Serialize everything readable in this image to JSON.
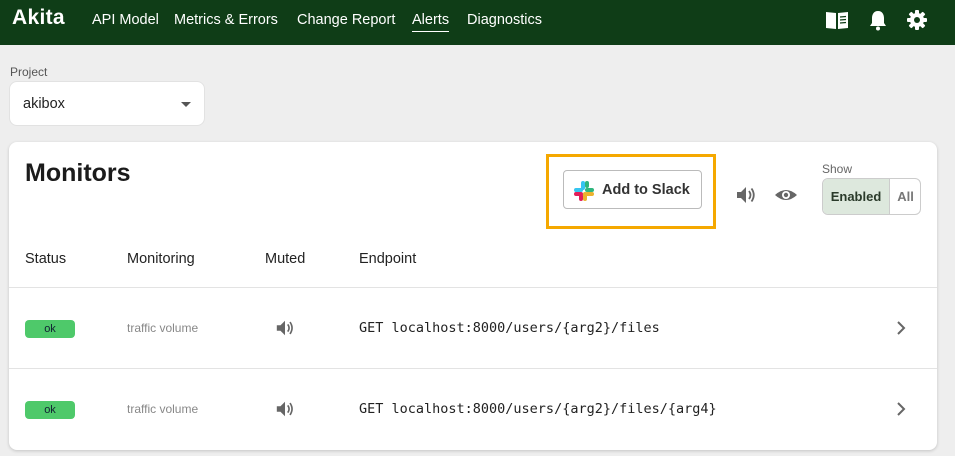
{
  "topbar": {
    "logo": "Akita",
    "nav": [
      {
        "label": "API Model",
        "active": false
      },
      {
        "label": "Metrics & Errors",
        "active": false
      },
      {
        "label": "Change Report",
        "active": false
      },
      {
        "label": "Alerts",
        "active": true
      },
      {
        "label": "Diagnostics",
        "active": false
      }
    ],
    "icons": [
      "book-icon",
      "bell-icon",
      "gear-icon"
    ],
    "background": "#0f3d17"
  },
  "project": {
    "label": "Project",
    "value": "akibox"
  },
  "monitors": {
    "title": "Monitors",
    "slack_button": "Add to Slack",
    "highlight_color": "#f5a800",
    "header_icons": [
      "speaker-icon",
      "eye-icon"
    ],
    "show": {
      "label": "Show",
      "options": [
        "Enabled",
        "All"
      ],
      "selected": "Enabled"
    },
    "columns": [
      "Status",
      "Monitoring",
      "Muted",
      "Endpoint"
    ],
    "rows": [
      {
        "status": "ok",
        "monitoring": "traffic volume",
        "muted_icon": "speaker-icon",
        "endpoint": "GET localhost:8000/users/{arg2}/files"
      },
      {
        "status": "ok",
        "monitoring": "traffic volume",
        "muted_icon": "speaker-icon",
        "endpoint": "GET localhost:8000/users/{arg2}/files/{arg4}"
      }
    ],
    "status_color": "#4ec96a"
  }
}
